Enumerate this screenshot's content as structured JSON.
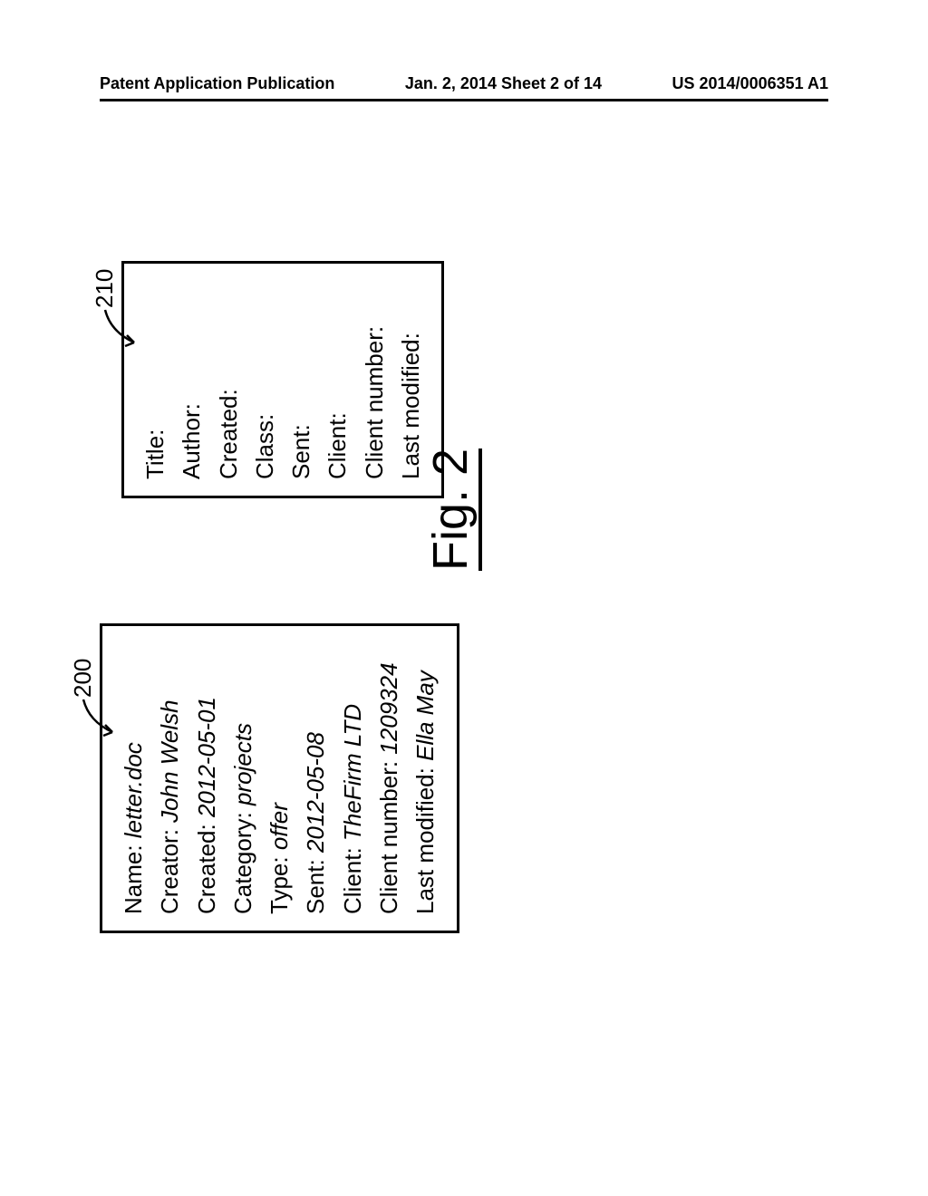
{
  "header": {
    "left": "Patent Application Publication",
    "center": "Jan. 2, 2014  Sheet 2 of 14",
    "right": "US 2014/0006351 A1"
  },
  "ref200": "200",
  "ref210": "210",
  "box200": {
    "rows": [
      {
        "label": "Name:",
        "value": "letter.doc"
      },
      {
        "label": "Creator:",
        "value": "John Welsh"
      },
      {
        "label": "Created:",
        "value": "2012-05-01"
      },
      {
        "label": "Category:",
        "value": "projects"
      },
      {
        "label": "Type:",
        "value": "offer"
      },
      {
        "label": "Sent:",
        "value": "2012-05-08"
      },
      {
        "label": "Client:",
        "value": "TheFirm LTD"
      },
      {
        "label": "Client number:",
        "value": "1209324"
      },
      {
        "label": "Last modified:",
        "value": "Ella May"
      }
    ]
  },
  "box210": {
    "rows": [
      {
        "label": "Title:",
        "value": ""
      },
      {
        "label": "Author:",
        "value": ""
      },
      {
        "label": "Created:",
        "value": ""
      },
      {
        "label": "Class:",
        "value": ""
      },
      {
        "label": "Sent:",
        "value": ""
      },
      {
        "label": "Client:",
        "value": ""
      },
      {
        "label": "Client number:",
        "value": ""
      },
      {
        "label": "Last modified:",
        "value": ""
      }
    ]
  },
  "figureLabel": "Fig. 2"
}
